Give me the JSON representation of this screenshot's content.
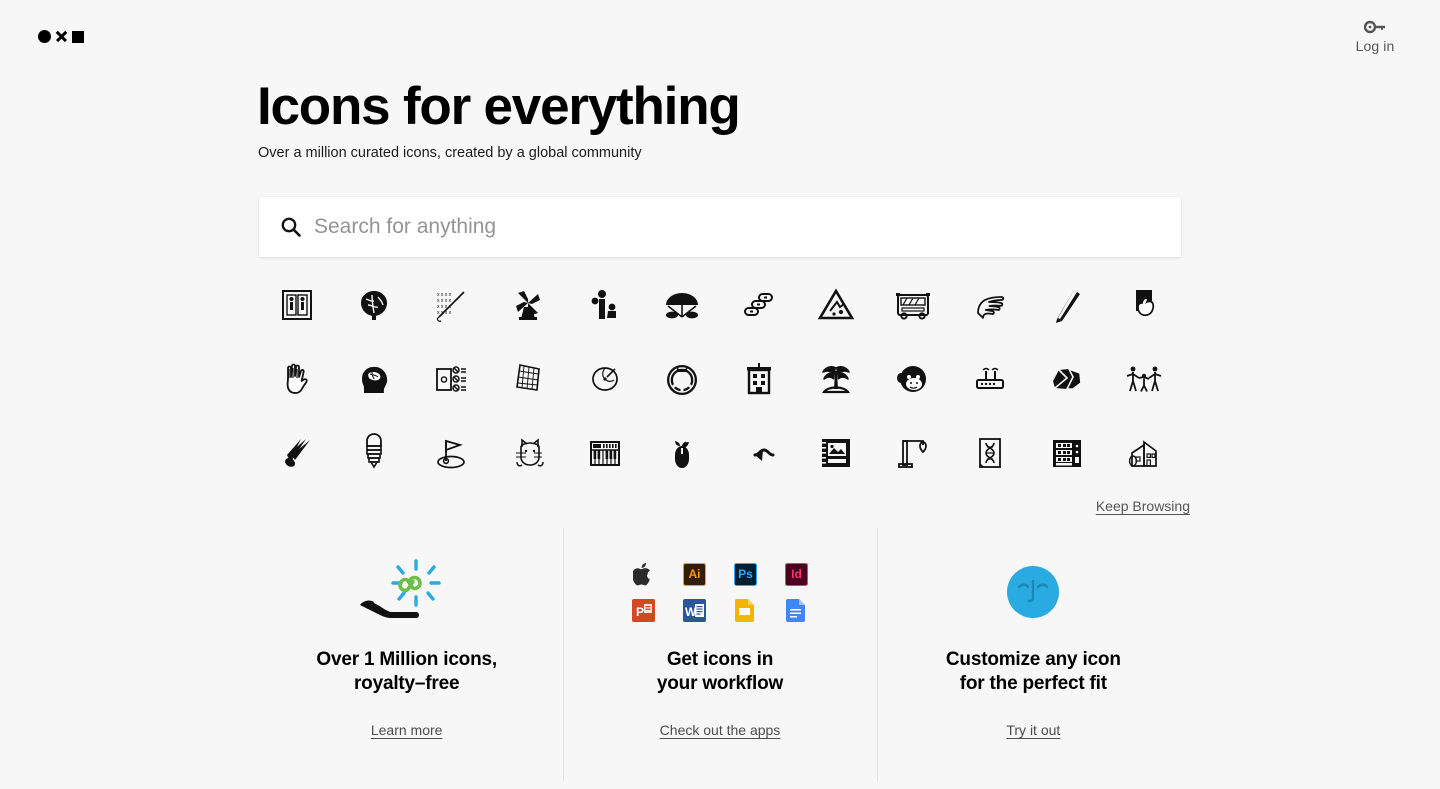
{
  "header": {
    "logo_name": "noun-project-logo",
    "login_icon": "key-icon",
    "login_label": "Log in"
  },
  "hero": {
    "title": "Icons for everything",
    "subtitle": "Over a million curated icons, created by a global community"
  },
  "search": {
    "icon": "search-icon",
    "placeholder": "Search for anything",
    "value": ""
  },
  "icon_grid": {
    "keep_browsing_label": "Keep Browsing",
    "icons": [
      "elevator-people-icon",
      "brain-tree-icon",
      "cross-stitch-needle-icon",
      "windmill-icon",
      "people-standing-icon",
      "parachute-icon",
      "stacked-coins-icon",
      "landslide-warning-icon",
      "school-bus-icon",
      "pointing-hand-icon",
      "pen-icon",
      "hand-holding-card-icon",
      "glove-hand-icon",
      "head-brain-icon",
      "money-checklist-icon",
      "crumpled-net-icon",
      "apple-slice-icon",
      "wreath-icon",
      "apartment-building-icon",
      "palm-tree-island-icon",
      "monkey-face-icon",
      "wifi-router-icon",
      "rocks-icon",
      "family-holding-hands-icon",
      "shuttlecock-icon",
      "light-bulb-icon",
      "golf-flag-icon",
      "cat-icon",
      "piano-keyboard-icon",
      "computer-mouse-sprout-icon",
      "wavy-arrow-left-icon",
      "photo-album-icon",
      "crane-icon",
      "dna-document-icon",
      "vending-machine-icon",
      "house-icon"
    ]
  },
  "features": [
    {
      "art": "hand-infinity-icon",
      "title_line1": "Over 1 Million icons,",
      "title_line2": "royalty–free",
      "link": "Learn more"
    },
    {
      "art": "app-logos",
      "title_line1": "Get icons in",
      "title_line2": "your workflow",
      "link": "Check out the apps",
      "apps": [
        {
          "name": "apple-icon",
          "label": "",
          "bg": "transparent",
          "fg": "#2b2b2b"
        },
        {
          "name": "adobe-illustrator-icon",
          "label": "Ai",
          "bg": "#331d04",
          "fg": "#ff9a00",
          "border": "#ff9a00"
        },
        {
          "name": "adobe-photoshop-icon",
          "label": "Ps",
          "bg": "#021e2f",
          "fg": "#31a8ff",
          "border": "#31a8ff"
        },
        {
          "name": "adobe-indesign-icon",
          "label": "Id",
          "bg": "#49021f",
          "fg": "#ff3366",
          "border": "#ff3366"
        },
        {
          "name": "powerpoint-icon",
          "label": "P",
          "bg": "#d24726",
          "fg": "#ffffff"
        },
        {
          "name": "word-icon",
          "label": "W",
          "bg": "#2b579a",
          "fg": "#ffffff"
        },
        {
          "name": "google-slides-icon",
          "label": "",
          "bg": "#f4b400",
          "fg": "#ffffff"
        },
        {
          "name": "google-docs-icon",
          "label": "",
          "bg": "#4285f4",
          "fg": "#ffffff"
        }
      ]
    },
    {
      "art": "blue-face-icon",
      "title_line1": "Customize any icon",
      "title_line2": "for the perfect fit",
      "link": "Try it out"
    }
  ],
  "colors": {
    "page_bg": "#f7f7f7",
    "search_bg": "#ffffff",
    "text": "#111111",
    "muted": "#555555",
    "divider": "#e3e3e3",
    "accent_green": "#6cbe45",
    "accent_blue": "#29abe2"
  }
}
